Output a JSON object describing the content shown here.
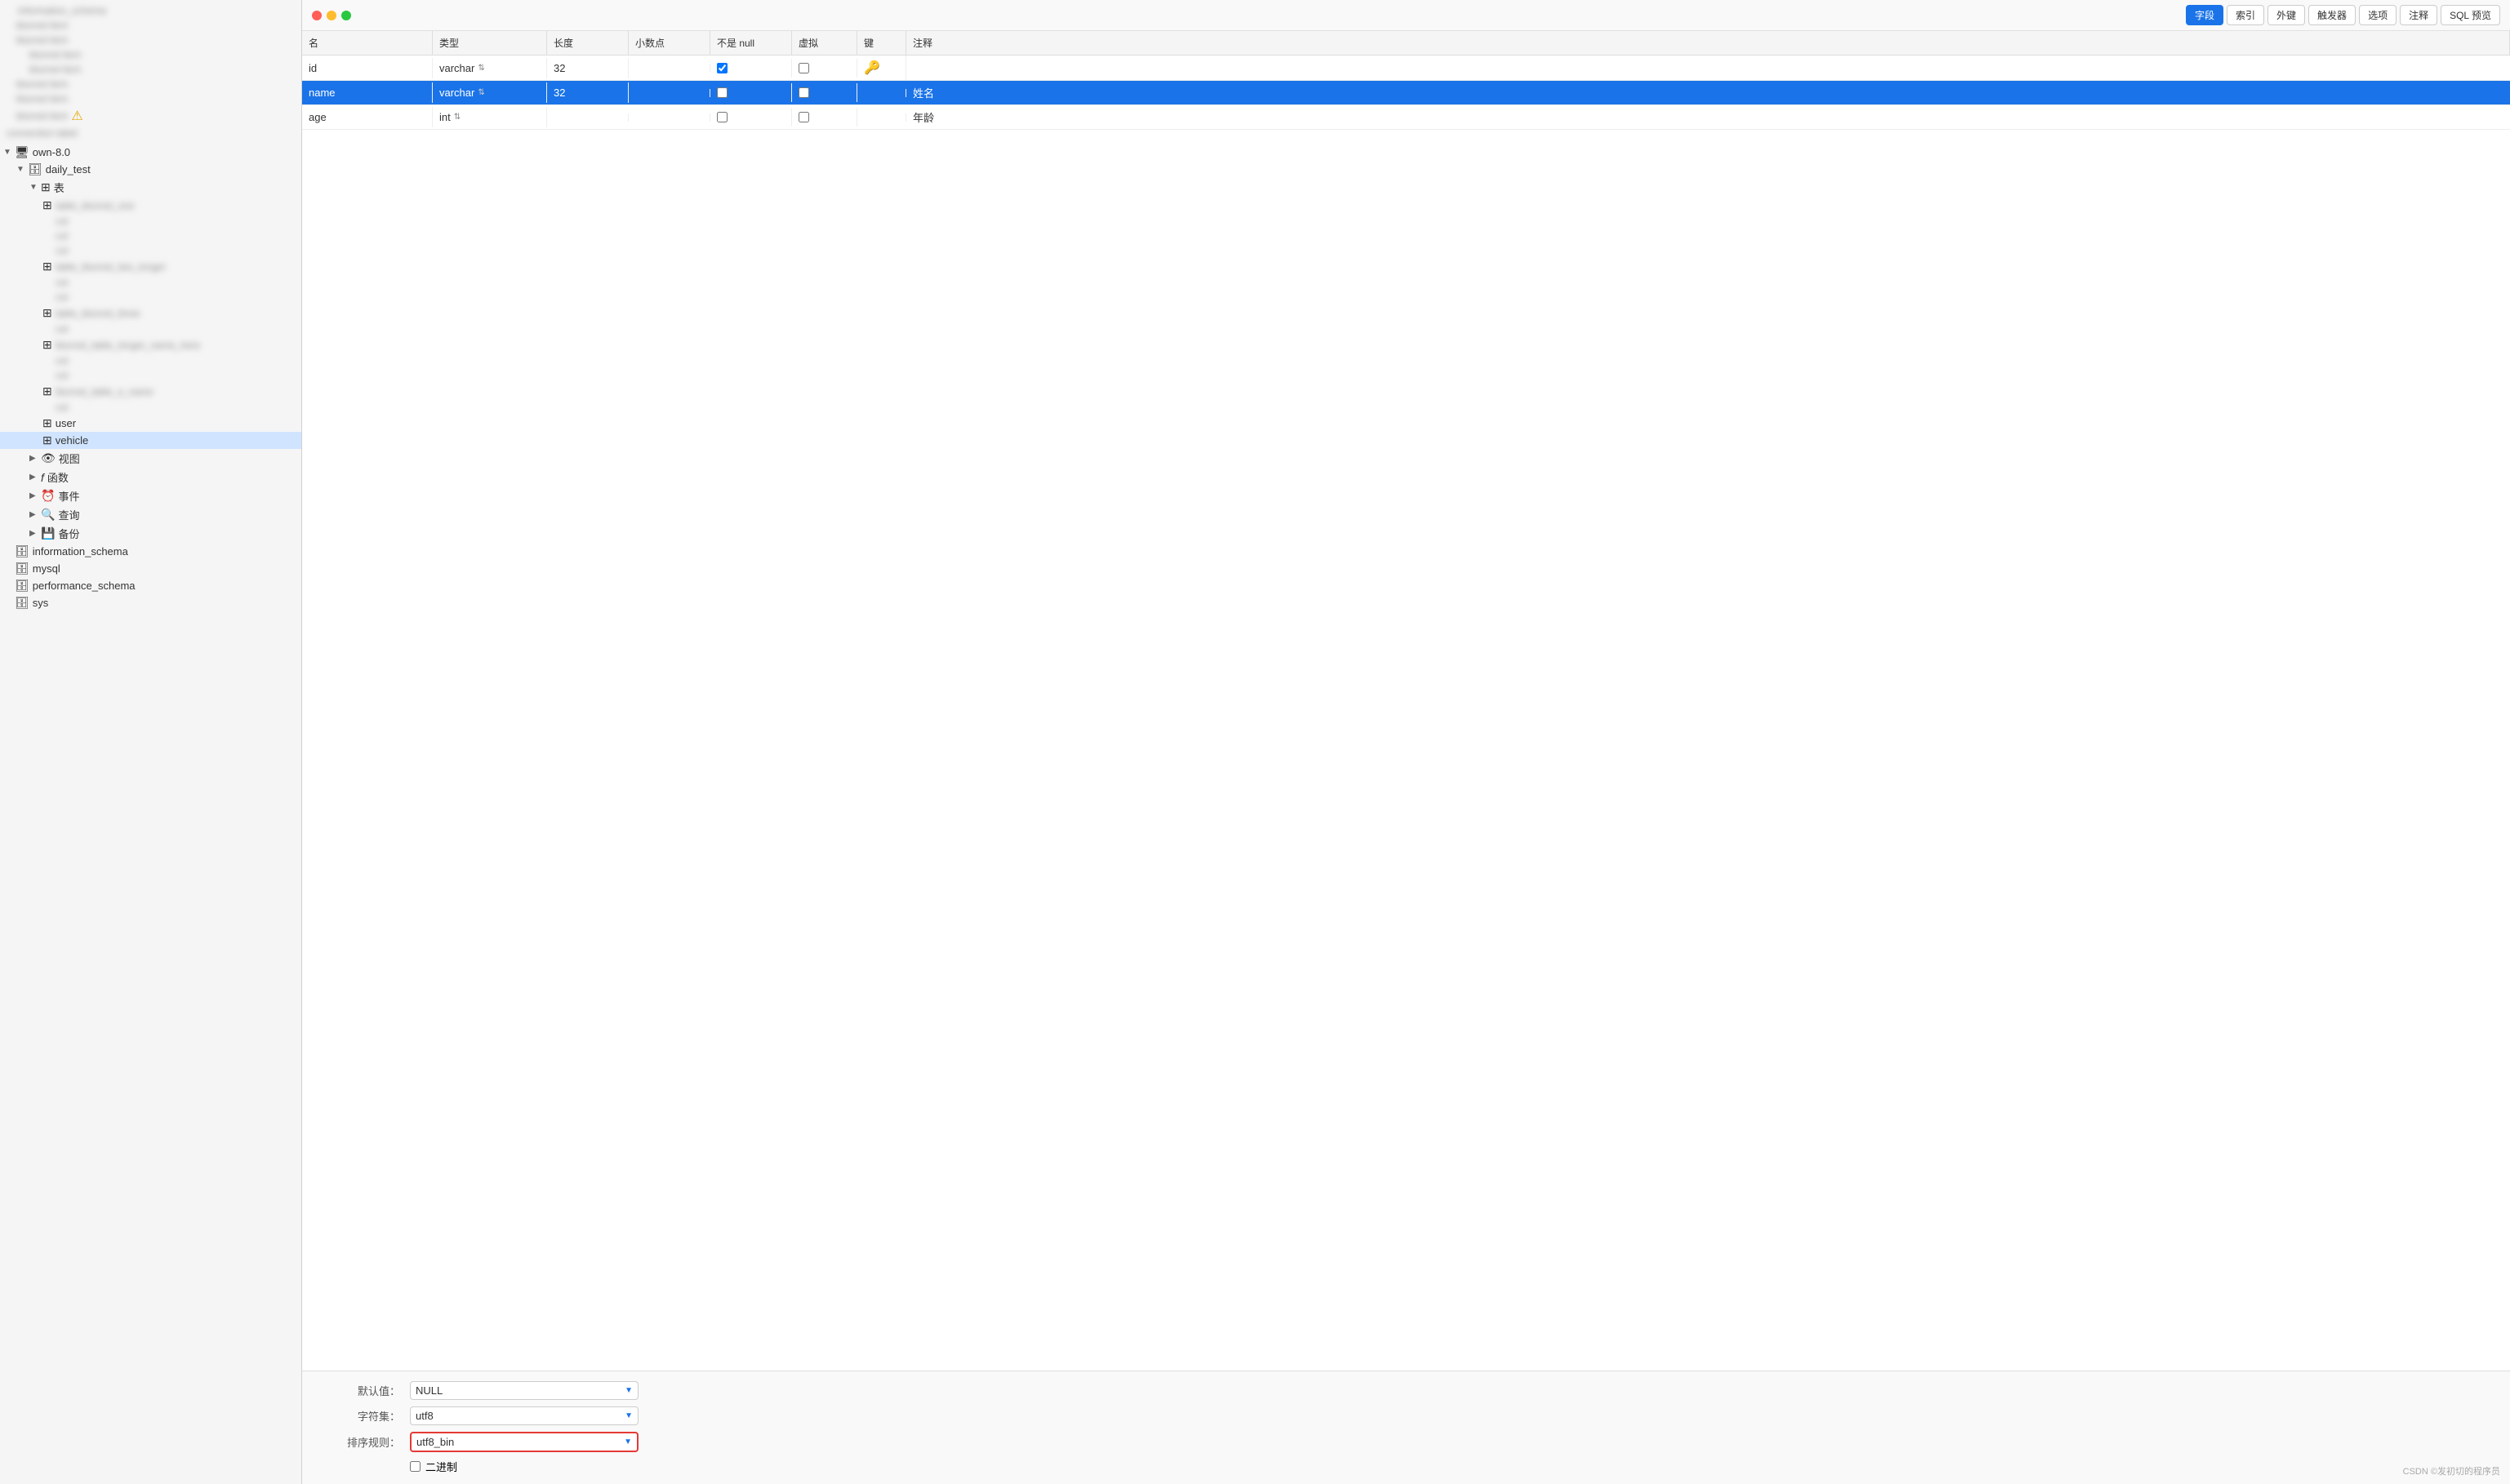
{
  "sidebar": {
    "items": [
      {
        "id": "own-80",
        "label": "own-8.0",
        "indent": 0,
        "arrow": "▼",
        "icon": "🖥",
        "type": "connection"
      },
      {
        "id": "daily-test",
        "label": "daily_test",
        "indent": 1,
        "arrow": "▼",
        "icon": "🗄",
        "type": "database"
      },
      {
        "id": "tables-group",
        "label": "表",
        "indent": 2,
        "arrow": "▼",
        "icon": "⊞",
        "type": "group"
      },
      {
        "id": "table-blurred-1",
        "label": "",
        "indent": 3,
        "arrow": "",
        "icon": "⊞",
        "type": "table",
        "blurred": true
      },
      {
        "id": "table-blurred-2",
        "label": "",
        "indent": 4,
        "arrow": "",
        "icon": "",
        "type": "item",
        "blurred": true
      },
      {
        "id": "table-blurred-3",
        "label": "",
        "indent": 4,
        "arrow": "",
        "icon": "",
        "type": "item",
        "blurred": true
      },
      {
        "id": "table-blurred-4",
        "label": "",
        "indent": 4,
        "arrow": "",
        "icon": "",
        "type": "item",
        "blurred": true
      },
      {
        "id": "table-blurred-5",
        "label": "",
        "indent": 3,
        "arrow": "",
        "icon": "⊞",
        "type": "table",
        "blurred": true
      },
      {
        "id": "table-blurred-6",
        "label": "",
        "indent": 4,
        "arrow": "",
        "icon": "",
        "type": "item",
        "blurred": true
      },
      {
        "id": "table-blurred-7",
        "label": "",
        "indent": 4,
        "arrow": "",
        "icon": "",
        "type": "item",
        "blurred": true
      },
      {
        "id": "table-blurred-8",
        "label": "",
        "indent": 3,
        "arrow": "",
        "icon": "⊞",
        "type": "table",
        "blurred": true
      },
      {
        "id": "table-blurred-9",
        "label": "",
        "indent": 4,
        "arrow": "",
        "icon": "",
        "type": "item",
        "blurred": true
      },
      {
        "id": "table-user",
        "label": "user",
        "indent": 3,
        "arrow": "",
        "icon": "⊞",
        "type": "table"
      },
      {
        "id": "table-vehicle",
        "label": "vehicle",
        "indent": 3,
        "arrow": "",
        "icon": "⊞",
        "type": "table"
      },
      {
        "id": "views-group",
        "label": "视图",
        "indent": 2,
        "arrow": "▶",
        "icon": "👁",
        "type": "group"
      },
      {
        "id": "funcs-group",
        "label": "函数",
        "indent": 2,
        "arrow": "▶",
        "icon": "𝑓",
        "type": "group"
      },
      {
        "id": "events-group",
        "label": "事件",
        "indent": 2,
        "arrow": "▶",
        "icon": "⏰",
        "type": "group"
      },
      {
        "id": "queries-group",
        "label": "查询",
        "indent": 2,
        "arrow": "▶",
        "icon": "🔍",
        "type": "group"
      },
      {
        "id": "backup-group",
        "label": "备份",
        "indent": 2,
        "arrow": "▶",
        "icon": "💾",
        "type": "group"
      },
      {
        "id": "info-schema",
        "label": "information_schema",
        "indent": 0,
        "arrow": "",
        "icon": "🗄",
        "type": "database"
      },
      {
        "id": "mysql-db",
        "label": "mysql",
        "indent": 0,
        "arrow": "",
        "icon": "🗄",
        "type": "database"
      },
      {
        "id": "perf-schema",
        "label": "performance_schema",
        "indent": 0,
        "arrow": "",
        "icon": "🗄",
        "type": "database"
      },
      {
        "id": "sys-db",
        "label": "sys",
        "indent": 0,
        "arrow": "",
        "icon": "🗄",
        "type": "database"
      }
    ]
  },
  "toolbar": {
    "tabs": [
      {
        "id": "field",
        "label": "字段",
        "active": true
      },
      {
        "id": "index",
        "label": "索引",
        "active": false
      },
      {
        "id": "foreign-key",
        "label": "外键",
        "active": false
      },
      {
        "id": "trigger",
        "label": "触发器",
        "active": false
      },
      {
        "id": "options",
        "label": "选项",
        "active": false
      },
      {
        "id": "comment",
        "label": "注释",
        "active": false
      },
      {
        "id": "sql-preview",
        "label": "SQL 预览",
        "active": false
      }
    ]
  },
  "columns": {
    "headers": [
      "名",
      "类型",
      "长度",
      "小数点",
      "不是 null",
      "虚拟",
      "键",
      "注释"
    ]
  },
  "fields": [
    {
      "name": "id",
      "type": "varchar",
      "length": "32",
      "decimal": "",
      "notnull": true,
      "virtual": false,
      "key": "🔑",
      "comment": ""
    },
    {
      "name": "name",
      "type": "varchar",
      "length": "32",
      "decimal": "",
      "notnull": false,
      "virtual": false,
      "key": "",
      "comment": "姓名",
      "selected": true
    },
    {
      "name": "age",
      "type": "int",
      "length": "",
      "decimal": "",
      "notnull": false,
      "virtual": false,
      "key": "",
      "comment": "年龄"
    }
  ],
  "bottom": {
    "default_label": "默认值：",
    "default_value": "NULL",
    "charset_label": "字符集：",
    "charset_value": "utf8",
    "collation_label": "排序规则：",
    "collation_value": "utf8_bin",
    "binary_label": "二进制",
    "binary_checked": false
  },
  "watermark": "CSDN ©发初切的程序员"
}
